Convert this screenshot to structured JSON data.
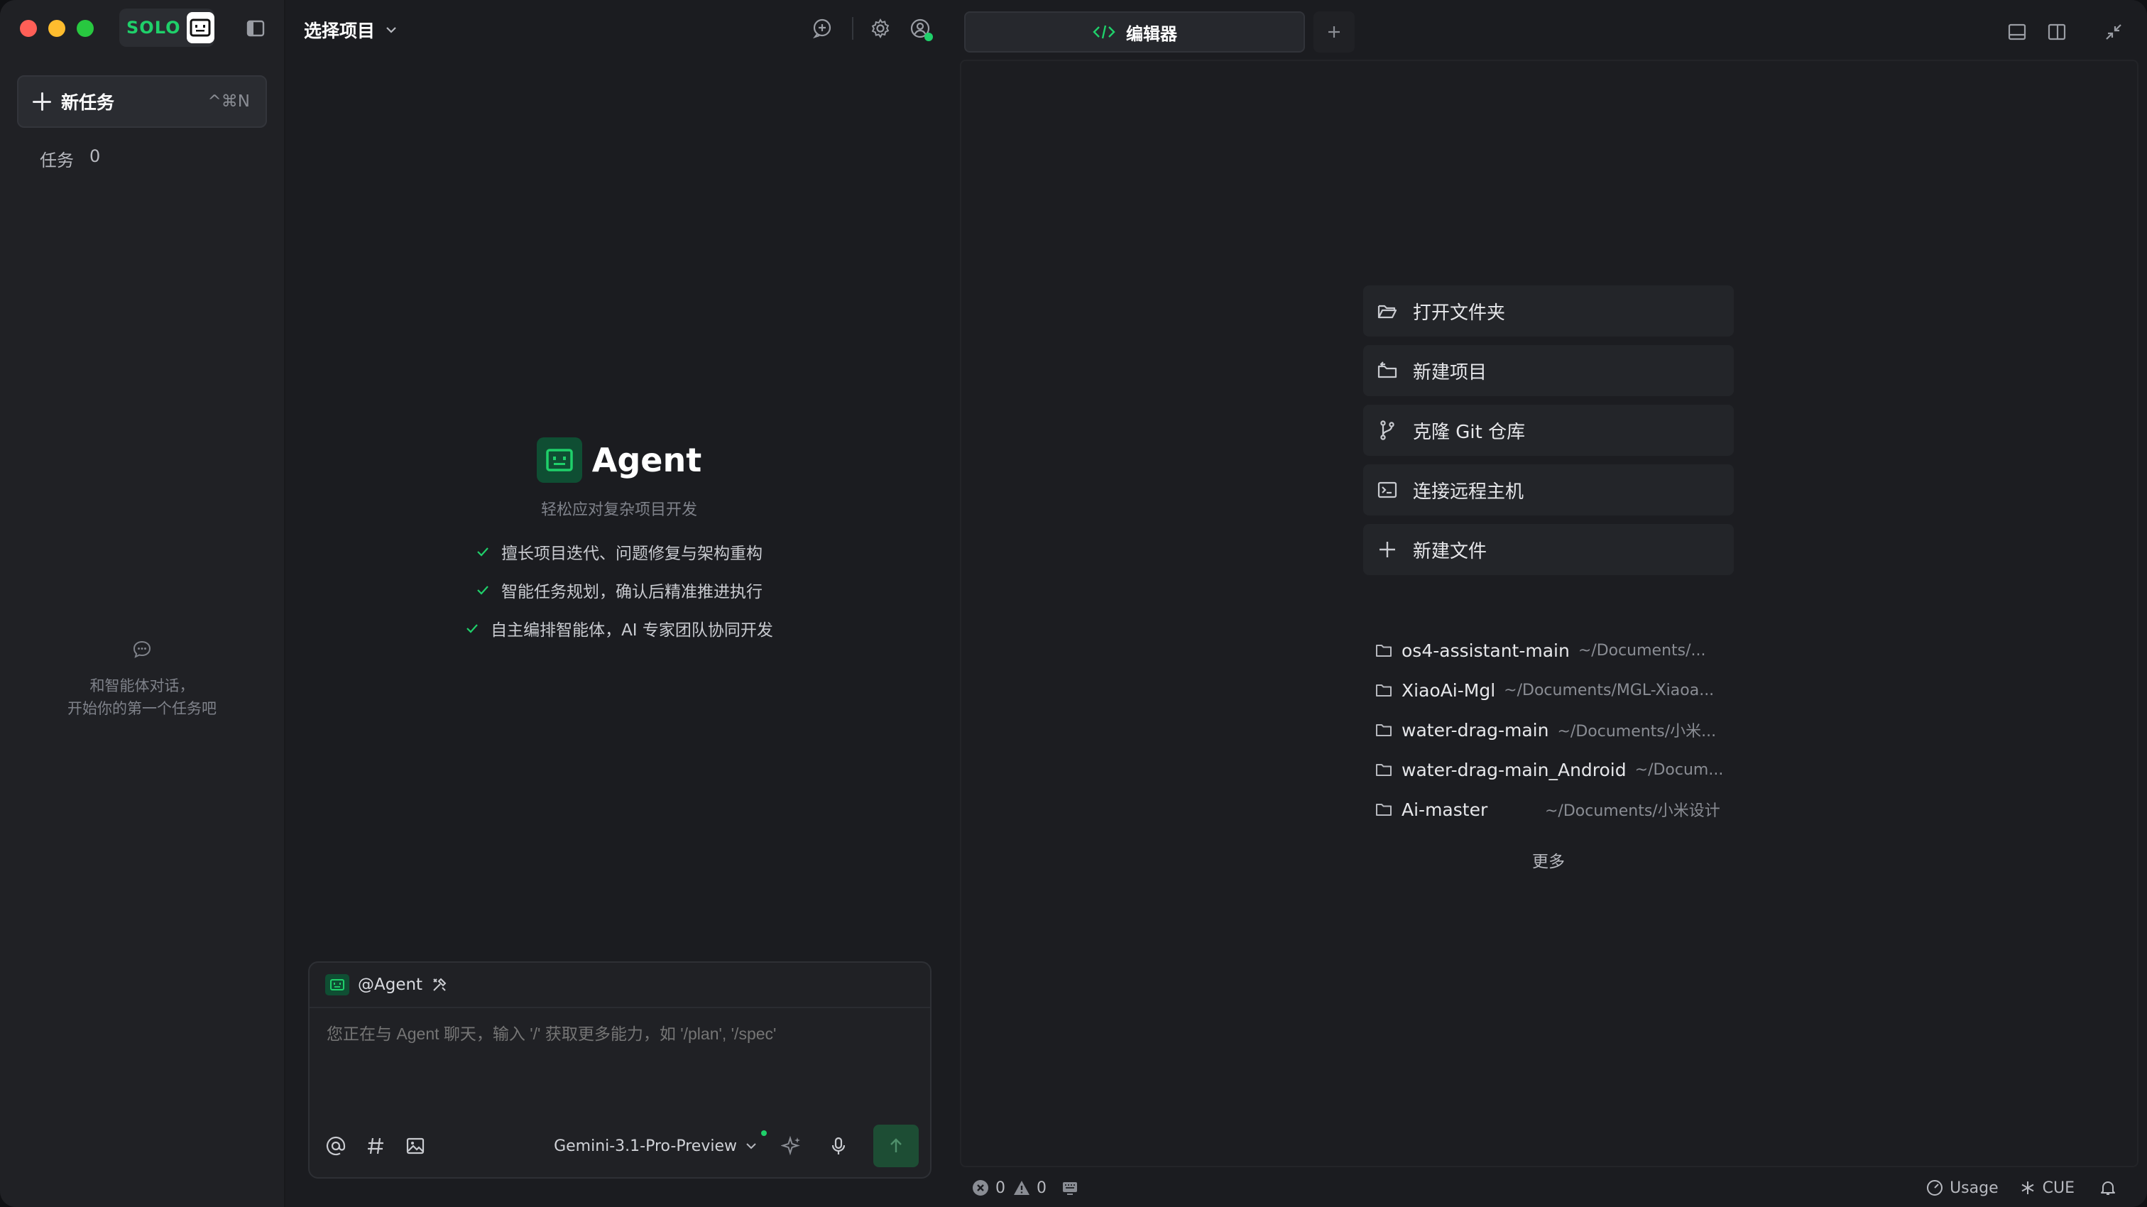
{
  "app": {
    "logo_text": "SOLO",
    "brand_color": "#1fd06a"
  },
  "sidebar": {
    "new_task_label": "新任务",
    "new_task_shortcut": "^⌘N",
    "tasks_label": "任务",
    "tasks_count": "0",
    "empty_line1": "和智能体对话，",
    "empty_line2": "开始你的第一个任务吧"
  },
  "agent_panel": {
    "project_select": "选择项目",
    "title": "Agent",
    "subtitle": "轻松应对复杂项目开发",
    "features": [
      "擅长项目迭代、问题修复与架构重构",
      "智能任务规划，确认后精准推进执行",
      "自主编排智能体，AI 专家团队协同开发"
    ],
    "composer": {
      "agent_tag": "@Agent",
      "placeholder": "您正在与 Agent 聊天，输入 '/' 获取更多能力，如 '/plan', '/spec'",
      "model": "Gemini-3.1-Pro-Preview"
    }
  },
  "editor": {
    "tab_label": "编辑器",
    "actions": [
      {
        "label": "打开文件夹",
        "icon": "folder-open-icon"
      },
      {
        "label": "新建项目",
        "icon": "new-project-icon"
      },
      {
        "label": "克隆 Git 仓库",
        "icon": "git-branch-icon"
      },
      {
        "label": "连接远程主机",
        "icon": "terminal-icon"
      },
      {
        "label": "新建文件",
        "icon": "plus-icon"
      }
    ],
    "recents": [
      {
        "name": "os4-assistant-main",
        "path": "~/Documents/..."
      },
      {
        "name": "XiaoAi-Mgl",
        "path": "~/Documents/MGL-Xiaoa..."
      },
      {
        "name": "water-drag-main",
        "path": "~/Documents/小米..."
      },
      {
        "name": "water-drag-main_Android",
        "path": "~/Docum..."
      },
      {
        "name": "Ai-master",
        "path": "~/Documents/小米设计"
      }
    ],
    "more": "更多"
  },
  "statusbar": {
    "errors": "0",
    "warnings": "0",
    "usage": "Usage",
    "cue": "CUE"
  }
}
